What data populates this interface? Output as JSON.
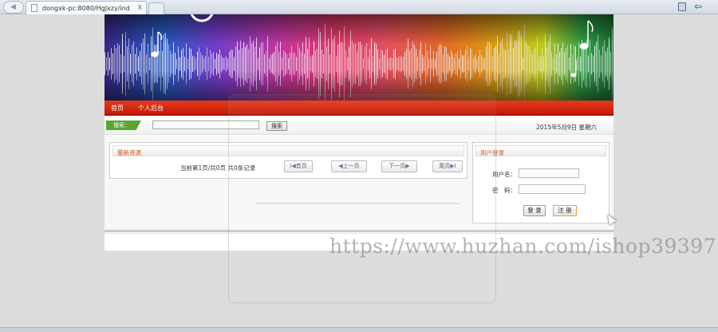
{
  "browser": {
    "tab_title": "dongxk-pc:8080/HgJxzy/ind",
    "tab_close": "X"
  },
  "menu": {
    "items": [
      "首页",
      "个人后台"
    ]
  },
  "search": {
    "label": "搜索：",
    "input_value": "",
    "button_label": "搜索"
  },
  "date_text": "2015年5月9日 星期六",
  "resources": {
    "title": "最新资源",
    "page_info": "当前第1页/共0页  共0条记录",
    "first": "首页",
    "prev": "上一页",
    "next": "下一页",
    "last": "尾页"
  },
  "login": {
    "title": "用户登录",
    "username_label": "用户名：",
    "password_label": "密　码：",
    "login_button": "登 录",
    "register_button": "注 册"
  },
  "watermark": "https://www.huzhan.com/ishop39397",
  "colors": {
    "menu_red": "#d42a12",
    "badge_green": "#58a531",
    "panel_title_orange": "#d05a1c"
  }
}
